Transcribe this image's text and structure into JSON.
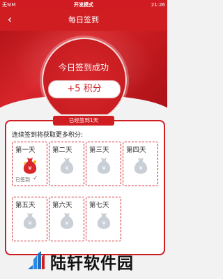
{
  "status": {
    "left": "无SIM",
    "center": "开发模式",
    "right": "21:26"
  },
  "nav": {
    "title": "每日签到"
  },
  "hero": {
    "success": "今日签到成功",
    "points": "+5 积分"
  },
  "card": {
    "tab": "已经签到1天",
    "subtitle": "连续签到将获取更多积分:",
    "days": [
      {
        "label": "第一天",
        "signed": true,
        "signed_text": "已签到"
      },
      {
        "label": "第二天",
        "signed": false
      },
      {
        "label": "第三天",
        "signed": false
      },
      {
        "label": "第四天",
        "signed": false
      },
      {
        "label": "第五天",
        "signed": false
      },
      {
        "label": "第六天",
        "signed": false
      },
      {
        "label": "第七天",
        "signed": false
      }
    ]
  },
  "watermark": {
    "text": "陆轩软件园"
  },
  "colors": {
    "primary": "#d01d22",
    "bag_signed": "#d8262b",
    "bag_unsigned": "#c9cfd6"
  }
}
